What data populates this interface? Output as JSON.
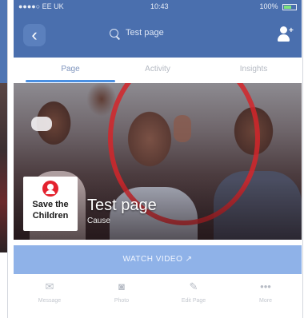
{
  "status_bar": {
    "carrier": "●●●●○ EE UK",
    "time": "10:43",
    "battery": "100%"
  },
  "nav": {
    "back_icon": "‹",
    "search_text": "Test page",
    "person_icon": "person-add-icon"
  },
  "tabs": [
    {
      "label": "Page"
    },
    {
      "label": "Activity"
    },
    {
      "label": "Insights"
    }
  ],
  "cover": {
    "logo_line1": "Save the",
    "logo_line2": "Children",
    "page_name": "Test page",
    "category": "Cause"
  },
  "cta": {
    "label": "WATCH VIDEO ↗"
  },
  "actions": [
    {
      "icon": "message-icon",
      "glyph": "✉",
      "label": "Message"
    },
    {
      "icon": "camera-icon",
      "glyph": "◙",
      "label": "Photo"
    },
    {
      "icon": "pencil-icon",
      "glyph": "✎",
      "label": "Edit Page"
    },
    {
      "icon": "more-icon",
      "glyph": "•••",
      "label": "More"
    }
  ],
  "colors": {
    "navbar": "#4a6fae",
    "accent": "#4a90e2",
    "cta": "#8fb2e8",
    "ring": "#d3262a",
    "logo_red": "#e4222e"
  }
}
